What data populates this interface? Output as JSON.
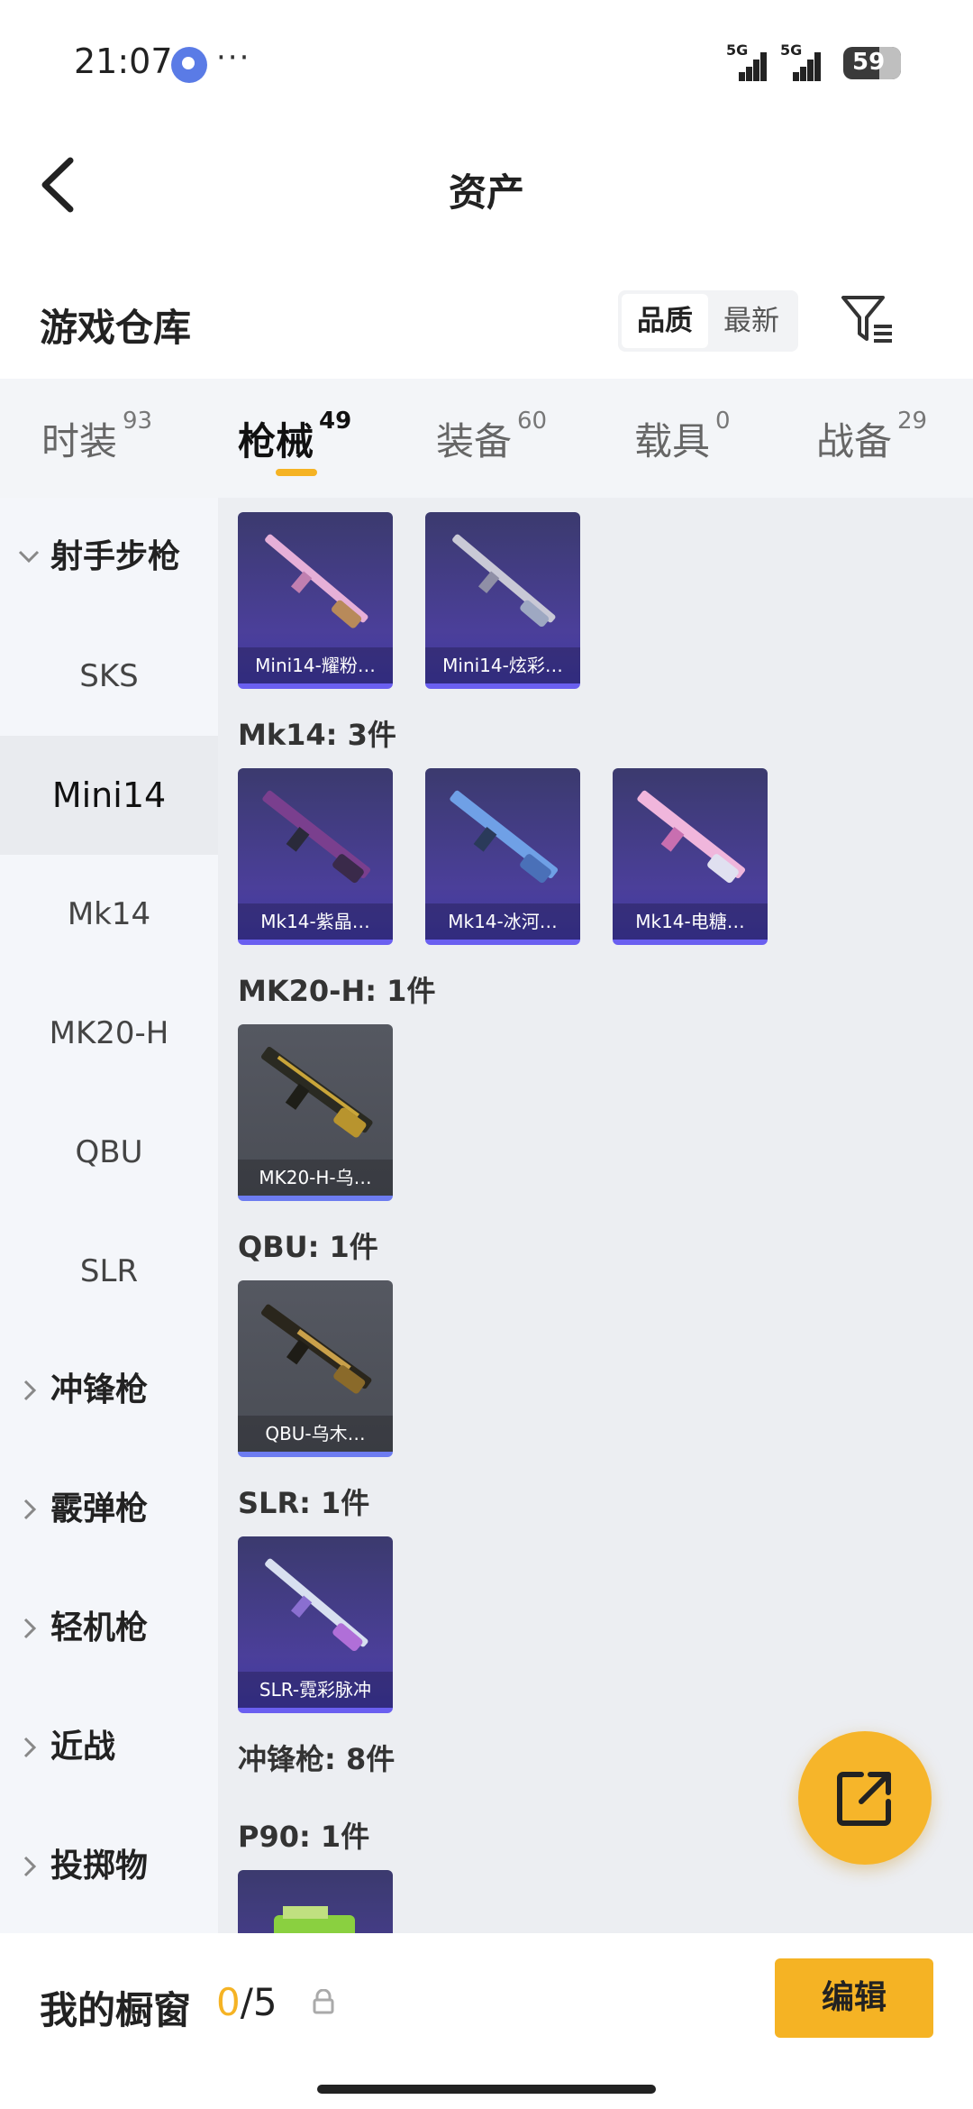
{
  "status_bar": {
    "time": "21:07",
    "dots": "···",
    "signal1_label": "5G",
    "signal2_label": "5G",
    "battery": "59"
  },
  "header": {
    "title": "资产"
  },
  "warehouse": {
    "title": "游戏仓库",
    "sort_quality": "品质",
    "sort_latest": "最新"
  },
  "tabs": [
    {
      "label": "时装",
      "count": "93"
    },
    {
      "label": "枪械",
      "count": "49"
    },
    {
      "label": "装备",
      "count": "60"
    },
    {
      "label": "载具",
      "count": "0"
    },
    {
      "label": "战备",
      "count": "29"
    }
  ],
  "sidebar": {
    "group_sniper": "射手步枪",
    "items": [
      "SKS",
      "Mini14",
      "Mk14",
      "MK20-H",
      "QBU",
      "SLR"
    ],
    "group_smg": "冲锋枪",
    "group_shotgun": "霰弹枪",
    "group_lmg": "轻机枪",
    "group_melee": "近战",
    "group_throw": "投掷物"
  },
  "content": {
    "mini14_items": [
      "Mini14-耀粉…",
      "Mini14-炫彩…"
    ],
    "mk14_label": "Mk14: 3件",
    "mk14_items": [
      "Mk14-紫晶…",
      "Mk14-冰河…",
      "Mk14-电糖…"
    ],
    "mk20_label": "MK20-H: 1件",
    "mk20_items": [
      "MK20-H-乌…"
    ],
    "qbu_label": "QBU: 1件",
    "qbu_items": [
      "QBU-乌木…"
    ],
    "slr_label": "SLR: 1件",
    "slr_items": [
      "SLR-霓彩脉冲"
    ],
    "smg_label": "冲锋枪: 8件",
    "p90_label": "P90: 1件"
  },
  "bottom_bar": {
    "title": "我的橱窗",
    "current": "0",
    "total": "/5",
    "edit": "编辑"
  },
  "colors": {
    "accent": "#f5b324",
    "rare_purple": "#4b3f9a",
    "card_gray": "#555861"
  }
}
